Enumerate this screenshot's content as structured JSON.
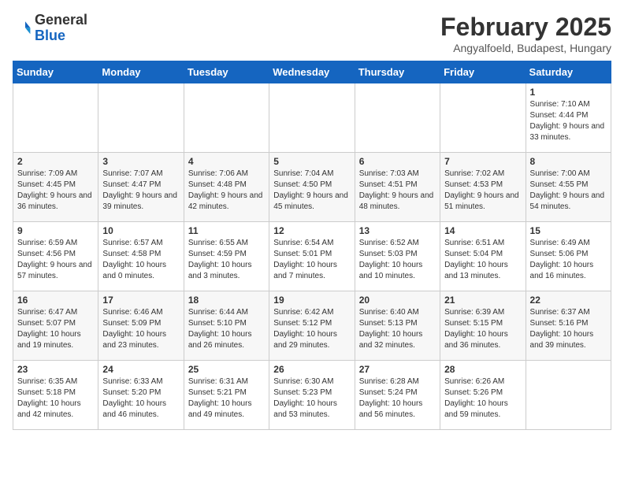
{
  "header": {
    "logo_general": "General",
    "logo_blue": "Blue",
    "title": "February 2025",
    "subtitle": "Angyalfoeld, Budapest, Hungary"
  },
  "weekdays": [
    "Sunday",
    "Monday",
    "Tuesday",
    "Wednesday",
    "Thursday",
    "Friday",
    "Saturday"
  ],
  "weeks": [
    [
      {
        "day": "",
        "info": ""
      },
      {
        "day": "",
        "info": ""
      },
      {
        "day": "",
        "info": ""
      },
      {
        "day": "",
        "info": ""
      },
      {
        "day": "",
        "info": ""
      },
      {
        "day": "",
        "info": ""
      },
      {
        "day": "1",
        "info": "Sunrise: 7:10 AM\nSunset: 4:44 PM\nDaylight: 9 hours and 33 minutes."
      }
    ],
    [
      {
        "day": "2",
        "info": "Sunrise: 7:09 AM\nSunset: 4:45 PM\nDaylight: 9 hours and 36 minutes."
      },
      {
        "day": "3",
        "info": "Sunrise: 7:07 AM\nSunset: 4:47 PM\nDaylight: 9 hours and 39 minutes."
      },
      {
        "day": "4",
        "info": "Sunrise: 7:06 AM\nSunset: 4:48 PM\nDaylight: 9 hours and 42 minutes."
      },
      {
        "day": "5",
        "info": "Sunrise: 7:04 AM\nSunset: 4:50 PM\nDaylight: 9 hours and 45 minutes."
      },
      {
        "day": "6",
        "info": "Sunrise: 7:03 AM\nSunset: 4:51 PM\nDaylight: 9 hours and 48 minutes."
      },
      {
        "day": "7",
        "info": "Sunrise: 7:02 AM\nSunset: 4:53 PM\nDaylight: 9 hours and 51 minutes."
      },
      {
        "day": "8",
        "info": "Sunrise: 7:00 AM\nSunset: 4:55 PM\nDaylight: 9 hours and 54 minutes."
      }
    ],
    [
      {
        "day": "9",
        "info": "Sunrise: 6:59 AM\nSunset: 4:56 PM\nDaylight: 9 hours and 57 minutes."
      },
      {
        "day": "10",
        "info": "Sunrise: 6:57 AM\nSunset: 4:58 PM\nDaylight: 10 hours and 0 minutes."
      },
      {
        "day": "11",
        "info": "Sunrise: 6:55 AM\nSunset: 4:59 PM\nDaylight: 10 hours and 3 minutes."
      },
      {
        "day": "12",
        "info": "Sunrise: 6:54 AM\nSunset: 5:01 PM\nDaylight: 10 hours and 7 minutes."
      },
      {
        "day": "13",
        "info": "Sunrise: 6:52 AM\nSunset: 5:03 PM\nDaylight: 10 hours and 10 minutes."
      },
      {
        "day": "14",
        "info": "Sunrise: 6:51 AM\nSunset: 5:04 PM\nDaylight: 10 hours and 13 minutes."
      },
      {
        "day": "15",
        "info": "Sunrise: 6:49 AM\nSunset: 5:06 PM\nDaylight: 10 hours and 16 minutes."
      }
    ],
    [
      {
        "day": "16",
        "info": "Sunrise: 6:47 AM\nSunset: 5:07 PM\nDaylight: 10 hours and 19 minutes."
      },
      {
        "day": "17",
        "info": "Sunrise: 6:46 AM\nSunset: 5:09 PM\nDaylight: 10 hours and 23 minutes."
      },
      {
        "day": "18",
        "info": "Sunrise: 6:44 AM\nSunset: 5:10 PM\nDaylight: 10 hours and 26 minutes."
      },
      {
        "day": "19",
        "info": "Sunrise: 6:42 AM\nSunset: 5:12 PM\nDaylight: 10 hours and 29 minutes."
      },
      {
        "day": "20",
        "info": "Sunrise: 6:40 AM\nSunset: 5:13 PM\nDaylight: 10 hours and 32 minutes."
      },
      {
        "day": "21",
        "info": "Sunrise: 6:39 AM\nSunset: 5:15 PM\nDaylight: 10 hours and 36 minutes."
      },
      {
        "day": "22",
        "info": "Sunrise: 6:37 AM\nSunset: 5:16 PM\nDaylight: 10 hours and 39 minutes."
      }
    ],
    [
      {
        "day": "23",
        "info": "Sunrise: 6:35 AM\nSunset: 5:18 PM\nDaylight: 10 hours and 42 minutes."
      },
      {
        "day": "24",
        "info": "Sunrise: 6:33 AM\nSunset: 5:20 PM\nDaylight: 10 hours and 46 minutes."
      },
      {
        "day": "25",
        "info": "Sunrise: 6:31 AM\nSunset: 5:21 PM\nDaylight: 10 hours and 49 minutes."
      },
      {
        "day": "26",
        "info": "Sunrise: 6:30 AM\nSunset: 5:23 PM\nDaylight: 10 hours and 53 minutes."
      },
      {
        "day": "27",
        "info": "Sunrise: 6:28 AM\nSunset: 5:24 PM\nDaylight: 10 hours and 56 minutes."
      },
      {
        "day": "28",
        "info": "Sunrise: 6:26 AM\nSunset: 5:26 PM\nDaylight: 10 hours and 59 minutes."
      },
      {
        "day": "",
        "info": ""
      }
    ]
  ]
}
